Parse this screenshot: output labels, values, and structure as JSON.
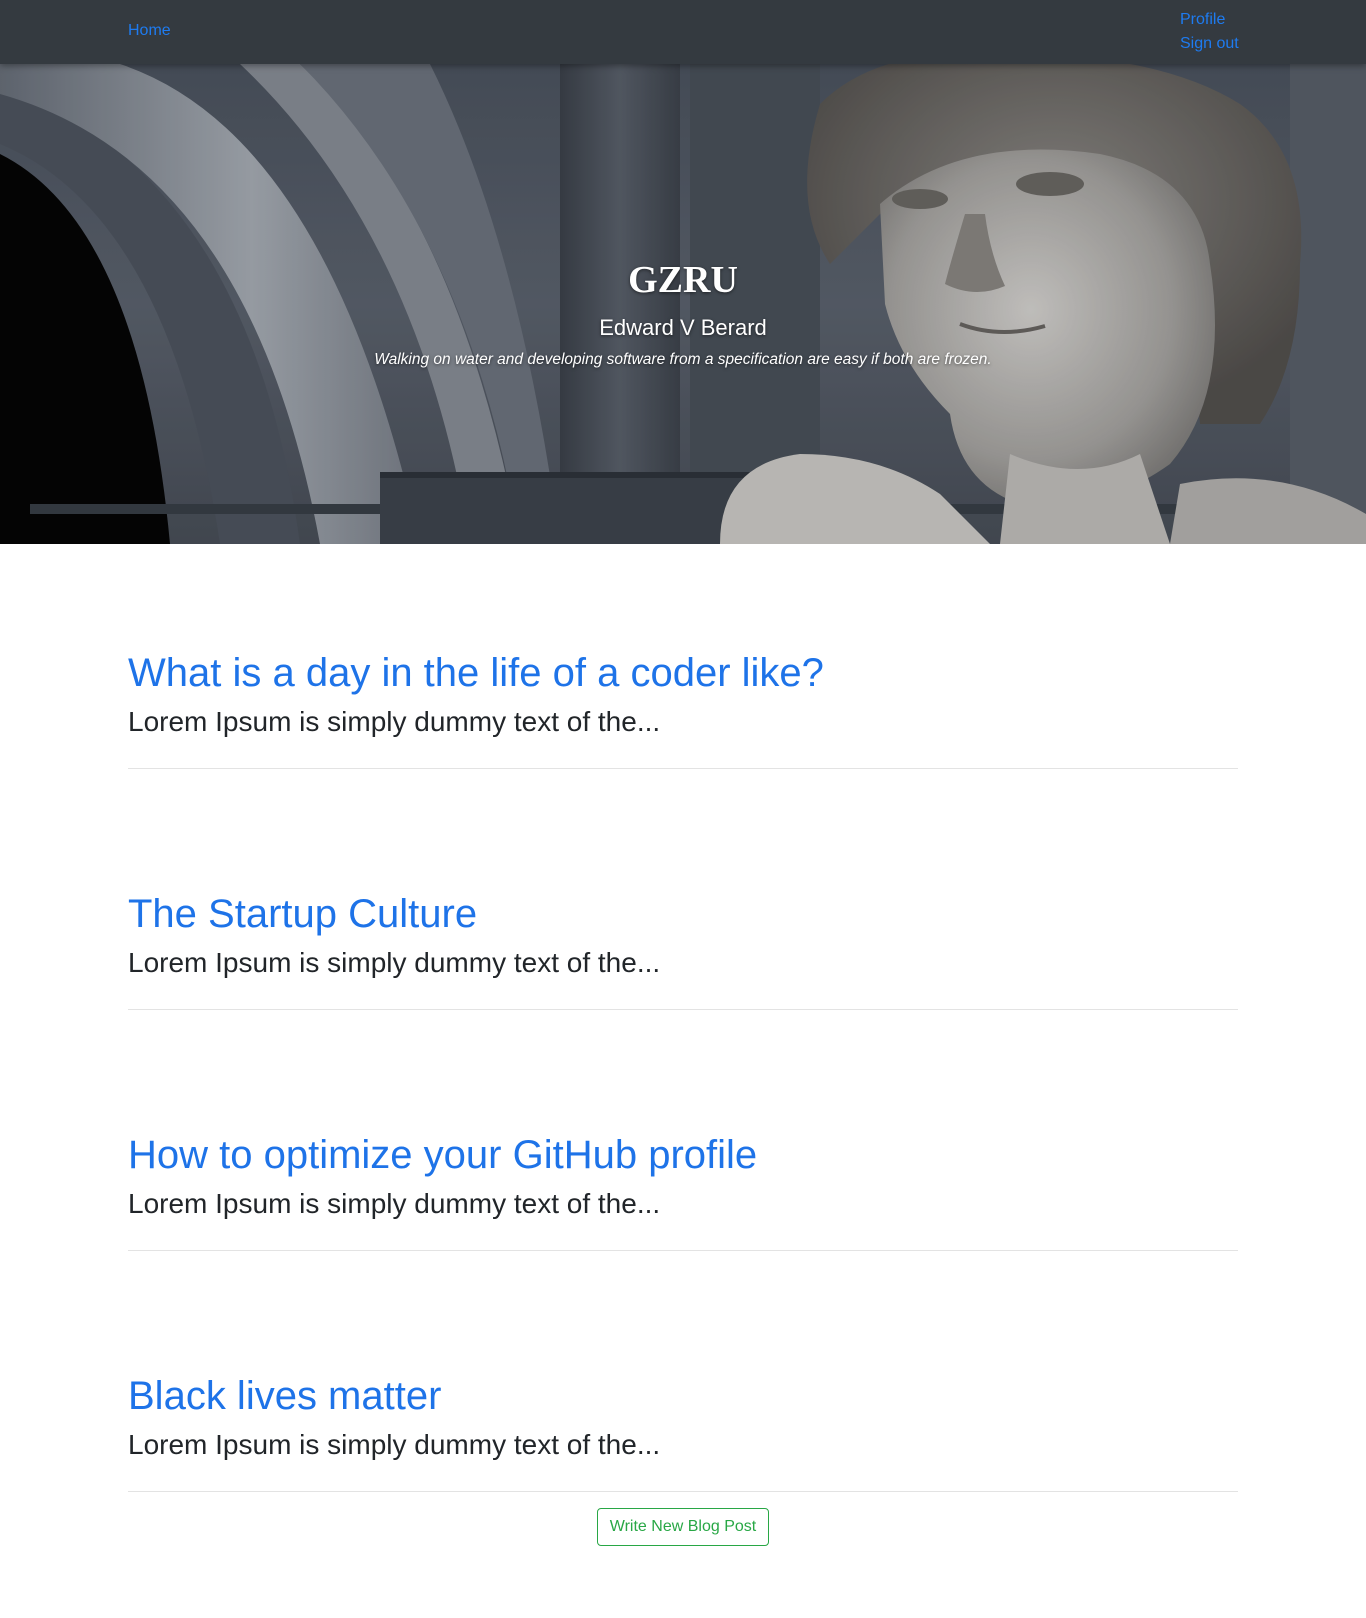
{
  "navbar": {
    "home_label": "Home",
    "profile_label": "Profile",
    "signout_label": "Sign out",
    "link_color": "#1e7bf0",
    "background": "#343a40"
  },
  "hero": {
    "title": "GZRU",
    "author": "Edward V Berard",
    "quote": "Walking on water and developing software from a specification are easy if both are frozen.",
    "image_subject": "statue-head-and-arches"
  },
  "posts": [
    {
      "title": "What is a day in the life of a coder like?",
      "excerpt": "Lorem Ipsum is simply dummy text of the..."
    },
    {
      "title": "The Startup Culture",
      "excerpt": "Lorem Ipsum is simply dummy text of the..."
    },
    {
      "title": "How to optimize your GitHub profile",
      "excerpt": "Lorem Ipsum is simply dummy text of the..."
    },
    {
      "title": "Black lives matter",
      "excerpt": "Lorem Ipsum is simply dummy text of the..."
    }
  ],
  "actions": {
    "write_post_label": "Write New Blog Post",
    "accent": "#28a745"
  }
}
